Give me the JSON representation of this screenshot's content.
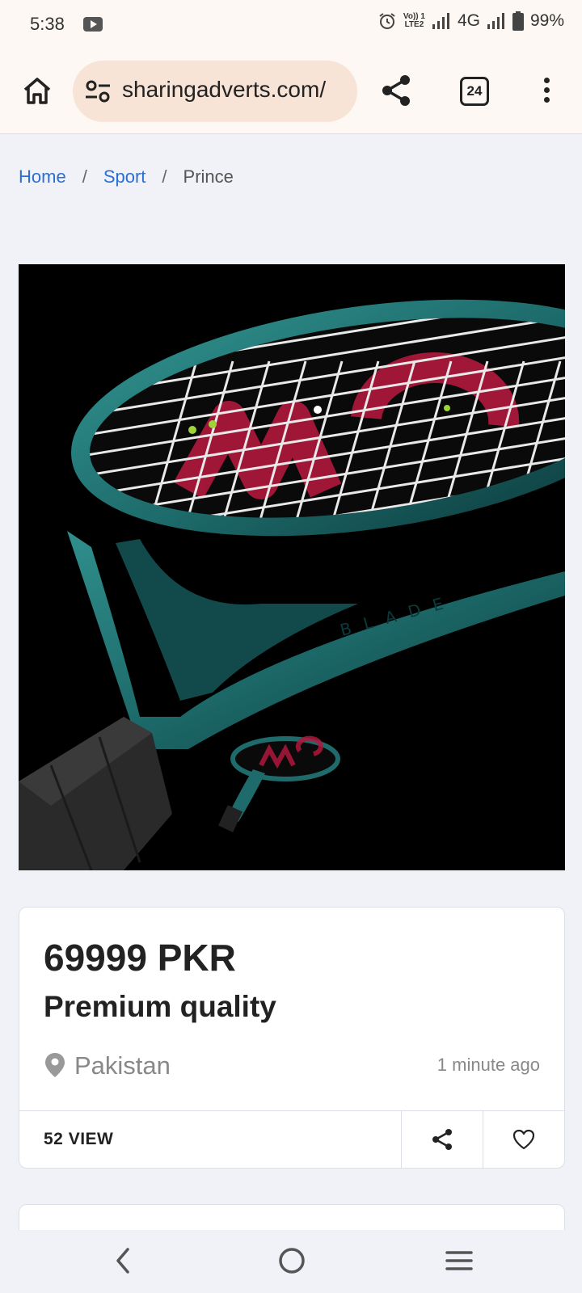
{
  "status_bar": {
    "time": "5:38",
    "network": "4G",
    "lte_label_top": "Vo)) 1",
    "lte_label_bottom": "LTE2",
    "battery": "99%"
  },
  "browser": {
    "url": "sharingadverts.com/",
    "tab_count": "24"
  },
  "breadcrumb": {
    "items": [
      {
        "label": "Home"
      },
      {
        "label": "Sport"
      },
      {
        "label": "Prince"
      }
    ],
    "separator": "/"
  },
  "product_image": {
    "brand_mark": "W",
    "racket_text": "BLADE",
    "racket_color": "#1f6b6b",
    "logo_color": "#b0183c"
  },
  "listing": {
    "price": "69999 PKR",
    "title": "Premium quality",
    "location": "Pakistan",
    "posted": "1 minute ago",
    "views": "52 VIEW"
  }
}
